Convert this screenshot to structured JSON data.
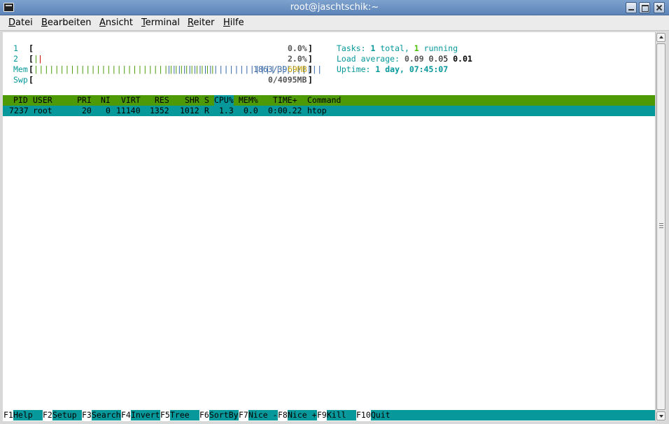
{
  "window": {
    "title": "root@jaschtschik:~"
  },
  "menu": [
    {
      "accel": "D",
      "rest": "atei"
    },
    {
      "accel": "B",
      "rest": "earbeiten"
    },
    {
      "accel": "A",
      "rest": "nsicht"
    },
    {
      "accel": "T",
      "rest": "erminal"
    },
    {
      "accel": "R",
      "rest": "eiter"
    },
    {
      "accel": "H",
      "rest": "ilfe"
    }
  ],
  "meters": {
    "cpu1": {
      "label": "1",
      "bars": "",
      "value": "0.0%"
    },
    "cpu2": {
      "label": "2",
      "bars_green": "|",
      "bars_red": "|",
      "value": "2.0%"
    },
    "mem": {
      "label": "Mem",
      "bars_green": "|||||||||||||||||||||||||||||||||||",
      "bars_blue": "||||||||||||||||||||||||||||||",
      "value_a": "1863/39",
      "value_b": "69MB"
    },
    "swp": {
      "label": "Swp",
      "value": "0/4095MB"
    }
  },
  "stats": {
    "tasks_label": "Tasks: ",
    "tasks_total": "1",
    "tasks_mid": " total, ",
    "tasks_running": "1",
    "tasks_end": " running",
    "load_label": "Load average: ",
    "load1": "0.09",
    "load5": "0.05",
    "load15": "0.01",
    "uptime_label": "Uptime: ",
    "uptime_value": "1 day, 07:45:07"
  },
  "table": {
    "headers": {
      "pid": "PID",
      "user": "USER",
      "pri": "PRI",
      "ni": "NI",
      "virt": "VIRT",
      "res": "RES",
      "shr": "SHR",
      "s": "S",
      "cpu": "CPU%",
      "mem": "MEM%",
      "time": "TIME+",
      "command": "Command"
    },
    "rows": [
      {
        "pid": "7237",
        "user": "root",
        "pri": "20",
        "ni": "0",
        "virt": "11140",
        "res": "1352",
        "shr": "1012",
        "s": "R",
        "cpu": "1.3",
        "mem": "0.0",
        "time": "0:00.22",
        "command": "htop"
      }
    ]
  },
  "fkeys": [
    {
      "key": "F1",
      "label": "Help  "
    },
    {
      "key": "F2",
      "label": "Setup "
    },
    {
      "key": "F3",
      "label": "Search"
    },
    {
      "key": "F4",
      "label": "Invert"
    },
    {
      "key": "F5",
      "label": "Tree  "
    },
    {
      "key": "F6",
      "label": "SortBy"
    },
    {
      "key": "F7",
      "label": "Nice -"
    },
    {
      "key": "F8",
      "label": "Nice +"
    },
    {
      "key": "F9",
      "label": "Kill  "
    },
    {
      "key": "F10",
      "label": "Quit"
    }
  ]
}
